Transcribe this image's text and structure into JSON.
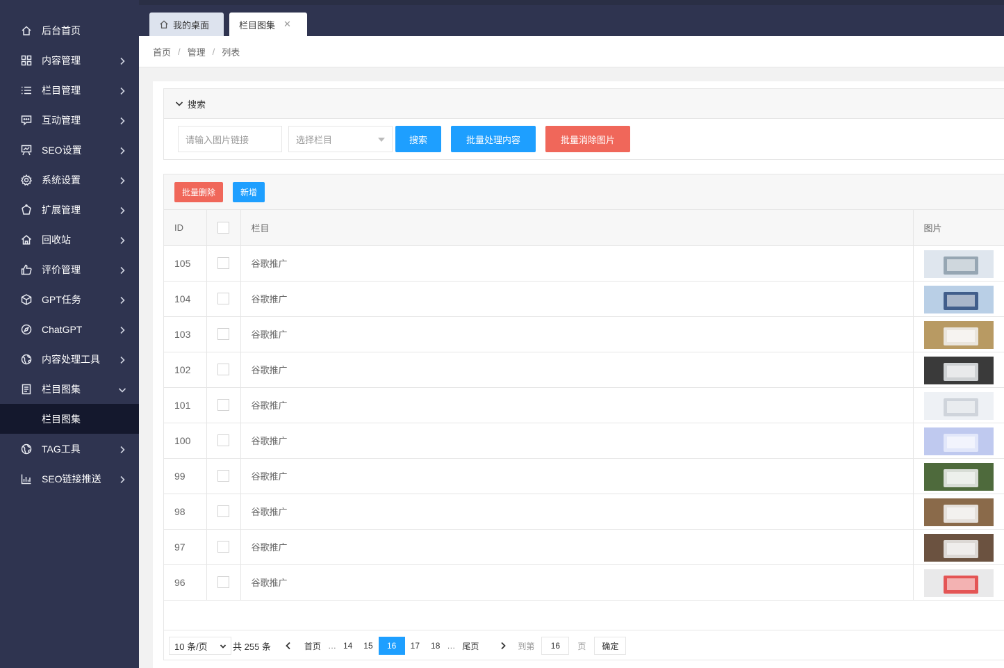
{
  "sidebar": {
    "items": [
      {
        "label": "后台首页",
        "icon": "home-icon",
        "has_arrow": false
      },
      {
        "label": "内容管理",
        "icon": "grid-icon",
        "has_arrow": true
      },
      {
        "label": "栏目管理",
        "icon": "list-icon",
        "has_arrow": true
      },
      {
        "label": "互动管理",
        "icon": "chat-icon",
        "has_arrow": true
      },
      {
        "label": "SEO设置",
        "icon": "chart-board-icon",
        "has_arrow": true
      },
      {
        "label": "系统设置",
        "icon": "gear-icon",
        "has_arrow": true
      },
      {
        "label": "扩展管理",
        "icon": "extension-icon",
        "has_arrow": true
      },
      {
        "label": "回收站",
        "icon": "home-roof-icon",
        "has_arrow": true
      },
      {
        "label": "评价管理",
        "icon": "thumbs-up-icon",
        "has_arrow": true
      },
      {
        "label": "GPT任务",
        "icon": "cube-icon",
        "has_arrow": true
      },
      {
        "label": "ChatGPT",
        "icon": "compass-icon",
        "has_arrow": true
      },
      {
        "label": "内容处理工具",
        "icon": "globe-icon",
        "has_arrow": true
      },
      {
        "label": "栏目图集",
        "icon": "document-icon",
        "has_arrow": true,
        "expanded": true
      },
      {
        "label": "TAG工具",
        "icon": "globe-icon",
        "has_arrow": true
      },
      {
        "label": "SEO链接推送",
        "icon": "bar-chart-icon",
        "has_arrow": true
      }
    ],
    "sub_item": "栏目图集"
  },
  "tabs": {
    "home": "我的桌面",
    "active": "栏目图集",
    "close_glyph": "✕"
  },
  "breadcrumb": [
    "首页",
    "管理",
    "列表"
  ],
  "search": {
    "title": "搜索",
    "url_placeholder": "请输入图片链接",
    "category_placeholder": "选择栏目",
    "search_button": "搜索",
    "batch_button": "批量处理内容",
    "purge_button": "批量消除图片"
  },
  "toolbar": {
    "delete_button": "批量删除",
    "add_button": "新增"
  },
  "table": {
    "headers": {
      "id": "ID",
      "category": "栏目",
      "image": "图片"
    },
    "rows": [
      {
        "id": "105",
        "category": "谷歌推广"
      },
      {
        "id": "104",
        "category": "谷歌推广"
      },
      {
        "id": "103",
        "category": "谷歌推广"
      },
      {
        "id": "102",
        "category": "谷歌推广"
      },
      {
        "id": "101",
        "category": "谷歌推广"
      },
      {
        "id": "100",
        "category": "谷歌推广"
      },
      {
        "id": "99",
        "category": "谷歌推广"
      },
      {
        "id": "98",
        "category": "谷歌推广"
      },
      {
        "id": "97",
        "category": "谷歌推广"
      },
      {
        "id": "96",
        "category": "谷歌推广"
      }
    ]
  },
  "pager": {
    "page_size": "10 条/页",
    "total": "共 255 条",
    "first": "首页",
    "last": "尾页",
    "pages": [
      "14",
      "15",
      "16",
      "17",
      "18"
    ],
    "current": "16",
    "dots": "…",
    "goto_label": "到第",
    "goto_value": "16",
    "unit": "页",
    "confirm": "确定"
  },
  "colors": {
    "sidebar_bg": "#2f3450",
    "sidebar_active_bg": "#14182d",
    "primary": "#1e9fff",
    "danger": "#f0675a"
  }
}
